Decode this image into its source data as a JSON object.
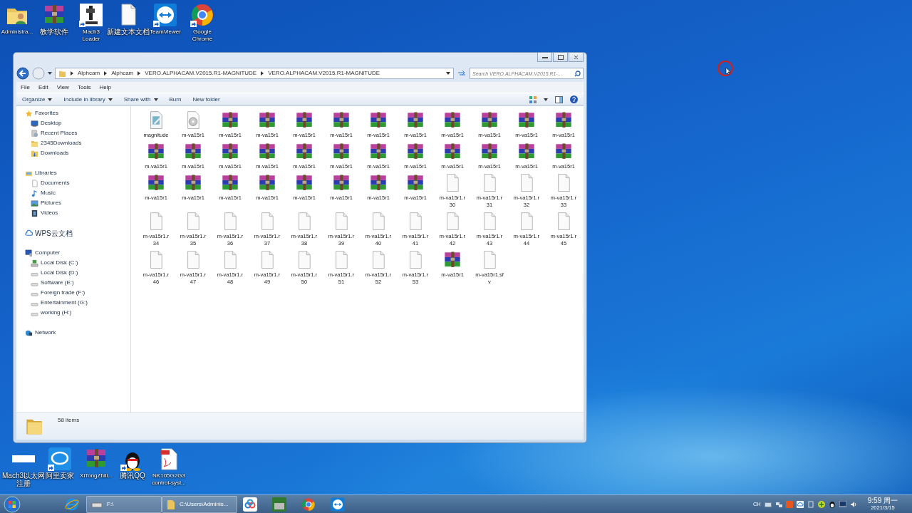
{
  "desktop_top": [
    {
      "lines": [
        "Administra..."
      ],
      "kind": "user-folder",
      "shortcut": false
    },
    {
      "lines": [
        "教学软件"
      ],
      "kind": "archive",
      "shortcut": false
    },
    {
      "lines": [
        "Mach3",
        "Loader"
      ],
      "kind": "machine",
      "shortcut": true
    },
    {
      "lines": [
        "新建文本文档"
      ],
      "kind": "blank",
      "shortcut": false
    },
    {
      "lines": [
        "TeamViewer"
      ],
      "kind": "arrows",
      "shortcut": true
    },
    {
      "lines": [
        "Google",
        "Chrome"
      ],
      "kind": "ring",
      "shortcut": true
    }
  ],
  "window": {
    "breadcrumbs": [
      "Alphcam",
      "Alphcam",
      "VERO.ALPHACAM.V2015.R1-MAGNiTUDE",
      "VERO.ALPHACAM.V2015.R1-MAGNiTUDE"
    ],
    "search": {
      "placeholder": "Search VERO.ALPHACAM.V2015.R1-..."
    },
    "menu": [
      "File",
      "Edit",
      "View",
      "Tools",
      "Help"
    ],
    "toolbar": [
      {
        "label": "Organize",
        "dropdown": true
      },
      {
        "label": "Include in library",
        "dropdown": true
      },
      {
        "label": "Share with",
        "dropdown": true
      },
      {
        "label": "Burn",
        "dropdown": false
      },
      {
        "label": "New folder",
        "dropdown": false
      }
    ],
    "nav": [
      {
        "label": "Favorites",
        "kind": "star",
        "children": [
          {
            "label": "Desktop",
            "kind": "desktop"
          },
          {
            "label": "Recent Places",
            "kind": "recent"
          },
          {
            "label": "2345Downloads",
            "kind": "folder"
          },
          {
            "label": "Downloads",
            "kind": "download"
          }
        ]
      },
      {
        "label": "Libraries",
        "kind": "library",
        "children": [
          {
            "label": "Documents",
            "kind": "documents"
          },
          {
            "label": "Music",
            "kind": "music"
          },
          {
            "label": "Pictures",
            "kind": "pictures"
          },
          {
            "label": "Videos",
            "kind": "videos"
          }
        ]
      },
      {
        "label": "WPS云文档",
        "kind": "cloud"
      },
      {
        "label": "Computer",
        "kind": "computer",
        "children": [
          {
            "label": "Local Disk (C:)",
            "kind": "system-drive"
          },
          {
            "label": "Local Disk (D:)",
            "kind": "drive"
          },
          {
            "label": "Software (E:)",
            "kind": "drive"
          },
          {
            "label": "Foreign trade (F:)",
            "kind": "drive"
          },
          {
            "label": "Entertainment (G:)",
            "kind": "drive"
          },
          {
            "label": "working (H:)",
            "kind": "drive"
          }
        ]
      },
      {
        "label": "Network",
        "kind": "network"
      }
    ],
    "files": [
      {
        "lines": [
          "magnitude"
        ],
        "kind": "doc"
      },
      {
        "lines": [
          "m-va15r1"
        ],
        "kind": "disc"
      },
      {
        "lines": [
          "m-va15r1"
        ],
        "kind": "archive"
      },
      {
        "lines": [
          "m-va15r1"
        ],
        "kind": "archive"
      },
      {
        "lines": [
          "m-va15r1"
        ],
        "kind": "archive"
      },
      {
        "lines": [
          "m-va15r1"
        ],
        "kind": "archive"
      },
      {
        "lines": [
          "m-va15r1"
        ],
        "kind": "archive"
      },
      {
        "lines": [
          "m-va15r1"
        ],
        "kind": "archive"
      },
      {
        "lines": [
          "m-va15r1"
        ],
        "kind": "archive"
      },
      {
        "lines": [
          "m-va15r1"
        ],
        "kind": "archive"
      },
      {
        "lines": [
          "m-va15r1"
        ],
        "kind": "archive"
      },
      {
        "lines": [
          "m-va15r1"
        ],
        "kind": "archive"
      },
      {
        "lines": [
          "m-va15r1"
        ],
        "kind": "archive"
      },
      {
        "lines": [
          "m-va15r1"
        ],
        "kind": "archive"
      },
      {
        "lines": [
          "m-va15r1"
        ],
        "kind": "archive"
      },
      {
        "lines": [
          "m-va15r1"
        ],
        "kind": "archive"
      },
      {
        "lines": [
          "m-va15r1"
        ],
        "kind": "archive"
      },
      {
        "lines": [
          "m-va15r1"
        ],
        "kind": "archive"
      },
      {
        "lines": [
          "m-va15r1"
        ],
        "kind": "archive"
      },
      {
        "lines": [
          "m-va15r1"
        ],
        "kind": "archive"
      },
      {
        "lines": [
          "m-va15r1"
        ],
        "kind": "archive"
      },
      {
        "lines": [
          "m-va15r1"
        ],
        "kind": "archive"
      },
      {
        "lines": [
          "m-va15r1"
        ],
        "kind": "archive"
      },
      {
        "lines": [
          "m-va15r1"
        ],
        "kind": "archive"
      },
      {
        "lines": [
          "m-va15r1"
        ],
        "kind": "archive"
      },
      {
        "lines": [
          "m-va15r1"
        ],
        "kind": "archive"
      },
      {
        "lines": [
          "m-va15r1"
        ],
        "kind": "archive"
      },
      {
        "lines": [
          "m-va15r1"
        ],
        "kind": "archive"
      },
      {
        "lines": [
          "m-va15r1"
        ],
        "kind": "archive"
      },
      {
        "lines": [
          "m-va15r1"
        ],
        "kind": "archive"
      },
      {
        "lines": [
          "m-va15r1"
        ],
        "kind": "archive"
      },
      {
        "lines": [
          "m-va15r1"
        ],
        "kind": "archive"
      },
      {
        "lines": [
          "m-va15r1.r",
          "30"
        ],
        "kind": "blank"
      },
      {
        "lines": [
          "m-va15r1.r",
          "31"
        ],
        "kind": "blank"
      },
      {
        "lines": [
          "m-va15r1.r",
          "32"
        ],
        "kind": "blank"
      },
      {
        "lines": [
          "m-va15r1.r",
          "33"
        ],
        "kind": "blank"
      },
      {
        "lines": [
          "m-va15r1.r",
          "34"
        ],
        "kind": "blank"
      },
      {
        "lines": [
          "m-va15r1.r",
          "35"
        ],
        "kind": "blank"
      },
      {
        "lines": [
          "m-va15r1.r",
          "36"
        ],
        "kind": "blank"
      },
      {
        "lines": [
          "m-va15r1.r",
          "37"
        ],
        "kind": "blank"
      },
      {
        "lines": [
          "m-va15r1.r",
          "38"
        ],
        "kind": "blank"
      },
      {
        "lines": [
          "m-va15r1.r",
          "39"
        ],
        "kind": "blank"
      },
      {
        "lines": [
          "m-va15r1.r",
          "40"
        ],
        "kind": "blank"
      },
      {
        "lines": [
          "m-va15r1.r",
          "41"
        ],
        "kind": "blank"
      },
      {
        "lines": [
          "m-va15r1.r",
          "42"
        ],
        "kind": "blank"
      },
      {
        "lines": [
          "m-va15r1.r",
          "43"
        ],
        "kind": "blank"
      },
      {
        "lines": [
          "m-va15r1.r",
          "44"
        ],
        "kind": "blank"
      },
      {
        "lines": [
          "m-va15r1.r",
          "45"
        ],
        "kind": "blank"
      },
      {
        "lines": [
          "m-va15r1.r",
          "46"
        ],
        "kind": "blank"
      },
      {
        "lines": [
          "m-va15r1.r",
          "47"
        ],
        "kind": "blank"
      },
      {
        "lines": [
          "m-va15r1.r",
          "48"
        ],
        "kind": "blank"
      },
      {
        "lines": [
          "m-va15r1.r",
          "49"
        ],
        "kind": "blank"
      },
      {
        "lines": [
          "m-va15r1.r",
          "50"
        ],
        "kind": "blank"
      },
      {
        "lines": [
          "m-va15r1.r",
          "51"
        ],
        "kind": "blank"
      },
      {
        "lines": [
          "m-va15r1.r",
          "52"
        ],
        "kind": "blank"
      },
      {
        "lines": [
          "m-va15r1.r",
          "53"
        ],
        "kind": "blank"
      },
      {
        "lines": [
          "m-va15r1"
        ],
        "kind": "archive"
      },
      {
        "lines": [
          "m-va15r1.sf",
          "v"
        ],
        "kind": "blank"
      }
    ],
    "status": "58 items"
  },
  "desktop_bottom": [
    {
      "lines": [
        "Mach3以太网",
        "注册"
      ],
      "kind": "white-bar",
      "shortcut": false
    },
    {
      "lines": [
        "阿里卖家"
      ],
      "kind": "bubble",
      "shortcut": true
    },
    {
      "lines": [
        "XiTongZhili..."
      ],
      "kind": "archive",
      "shortcut": false
    },
    {
      "lines": [
        "腾讯QQ"
      ],
      "kind": "penguin",
      "shortcut": true
    },
    {
      "lines": [
        "NK105G2G3",
        "control-syst..."
      ],
      "kind": "pdf",
      "shortcut": false
    }
  ],
  "taskbar": {
    "windows": [
      {
        "label": "F:\\",
        "kind": "drive"
      },
      {
        "label": "C:\\Users\\Adminis...",
        "kind": "folder"
      }
    ],
    "language": "CH",
    "time": "9:59 周一",
    "date": "2021/3/15"
  }
}
